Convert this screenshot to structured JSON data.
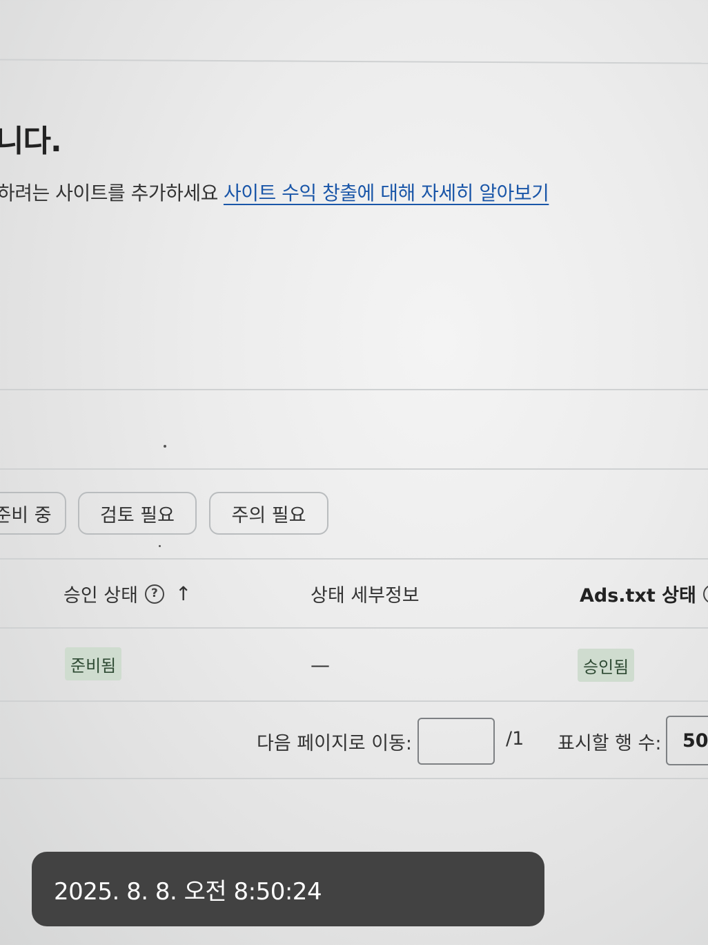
{
  "heading": "니다.",
  "description": {
    "text": "하려는 사이트를 추가하세요",
    "link": "사이트 수익 창출에 대해 자세히 알아보기"
  },
  "filters": [
    {
      "label": "준비 중"
    },
    {
      "label": "검토 필요"
    },
    {
      "label": "주의 필요"
    }
  ],
  "table": {
    "headers": {
      "approval_status": "승인 상태",
      "status_details": "상태 세부정보",
      "adstxt_status": "Ads.txt 상태"
    },
    "row": {
      "approval_status": "준비됨",
      "status_details": "—",
      "adstxt_status": "승인됨"
    }
  },
  "pagination": {
    "goto_label": "다음 페이지로 이동:",
    "goto_value": "",
    "total_pages": "/1",
    "rows_label": "표시할 행 수:",
    "rows_value": "50"
  },
  "toast": {
    "timestamp": "2025. 8. 8. 오전 8:50:24"
  },
  "colors": {
    "link": "#1a56a8",
    "badge_bg": "#cfdccf",
    "toast_bg": "#424242"
  },
  "icons": {
    "help": "question-circle-icon",
    "sort": "arrow-up-icon"
  }
}
